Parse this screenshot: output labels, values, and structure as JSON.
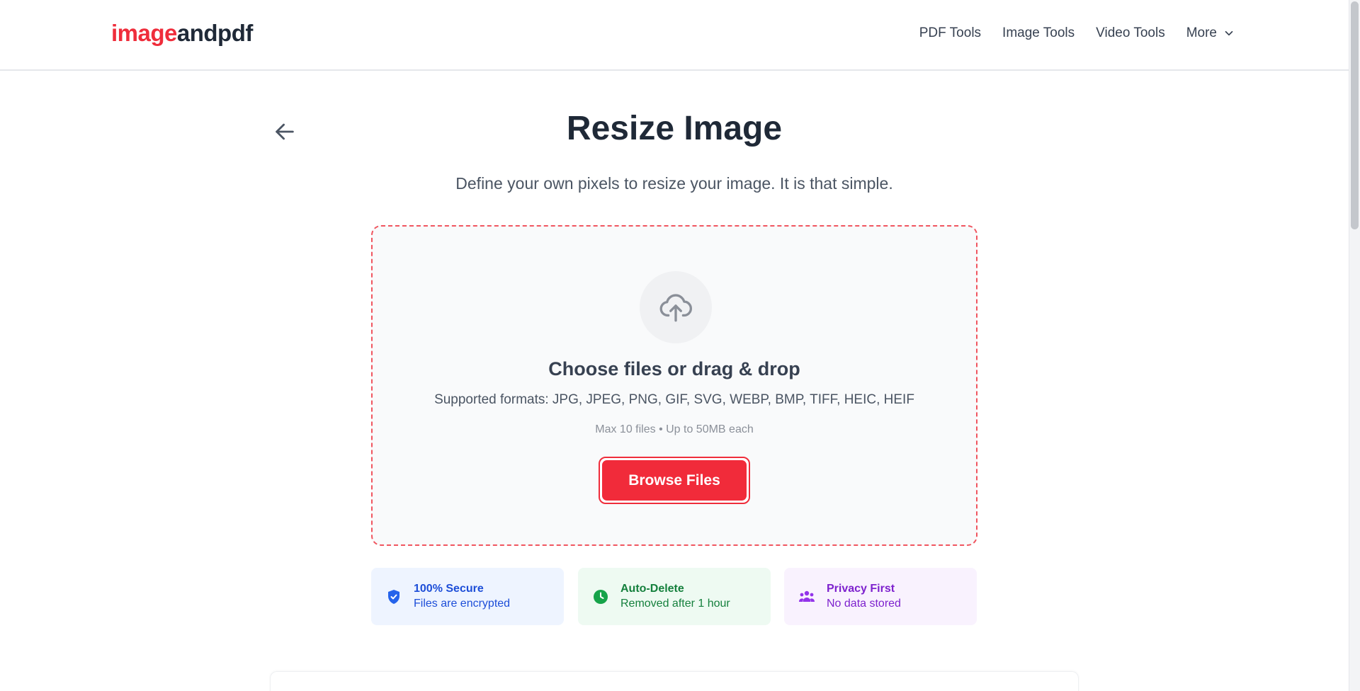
{
  "header": {
    "logo_part1": "image",
    "logo_part2": "andpdf",
    "nav": [
      {
        "label": "PDF Tools"
      },
      {
        "label": "Image Tools"
      },
      {
        "label": "Video Tools"
      },
      {
        "label": "More"
      }
    ]
  },
  "main": {
    "title": "Resize Image",
    "subtitle": "Define your own pixels to resize your image. It is that simple."
  },
  "dropzone": {
    "title": "Choose files or drag & drop",
    "formats": "Supported formats: JPG, JPEG, PNG, GIF, SVG, WEBP, BMP, TIFF, HEIC, HEIF",
    "limit": "Max 10 files • Up to 50MB each",
    "button": "Browse Files"
  },
  "features": [
    {
      "title": "100% Secure",
      "desc": "Files are encrypted",
      "icon": "shield-check-icon",
      "color": "#1d4ed8"
    },
    {
      "title": "Auto-Delete",
      "desc": "Removed after 1 hour",
      "icon": "clock-icon",
      "color": "#15803d"
    },
    {
      "title": "Privacy First",
      "desc": "No data stored",
      "icon": "users-icon",
      "color": "#7e22ce"
    }
  ],
  "colors": {
    "brand": "#ef2d3b",
    "text_dark": "#1f2937"
  }
}
